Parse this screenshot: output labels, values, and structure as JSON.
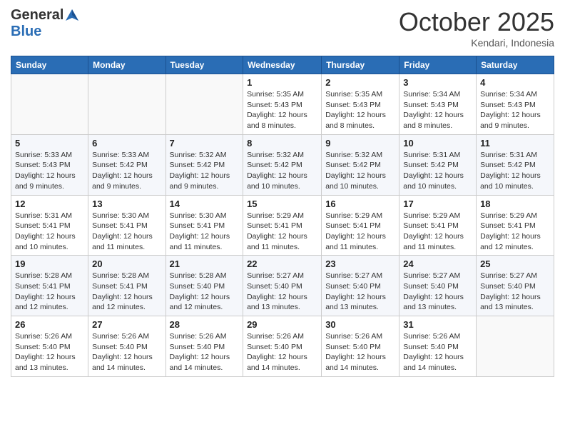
{
  "header": {
    "logo_general": "General",
    "logo_blue": "Blue",
    "month": "October 2025",
    "location": "Kendari, Indonesia"
  },
  "weekdays": [
    "Sunday",
    "Monday",
    "Tuesday",
    "Wednesday",
    "Thursday",
    "Friday",
    "Saturday"
  ],
  "weeks": [
    [
      {
        "day": "",
        "info": ""
      },
      {
        "day": "",
        "info": ""
      },
      {
        "day": "",
        "info": ""
      },
      {
        "day": "1",
        "info": "Sunrise: 5:35 AM\nSunset: 5:43 PM\nDaylight: 12 hours\nand 8 minutes."
      },
      {
        "day": "2",
        "info": "Sunrise: 5:35 AM\nSunset: 5:43 PM\nDaylight: 12 hours\nand 8 minutes."
      },
      {
        "day": "3",
        "info": "Sunrise: 5:34 AM\nSunset: 5:43 PM\nDaylight: 12 hours\nand 8 minutes."
      },
      {
        "day": "4",
        "info": "Sunrise: 5:34 AM\nSunset: 5:43 PM\nDaylight: 12 hours\nand 9 minutes."
      }
    ],
    [
      {
        "day": "5",
        "info": "Sunrise: 5:33 AM\nSunset: 5:43 PM\nDaylight: 12 hours\nand 9 minutes."
      },
      {
        "day": "6",
        "info": "Sunrise: 5:33 AM\nSunset: 5:42 PM\nDaylight: 12 hours\nand 9 minutes."
      },
      {
        "day": "7",
        "info": "Sunrise: 5:32 AM\nSunset: 5:42 PM\nDaylight: 12 hours\nand 9 minutes."
      },
      {
        "day": "8",
        "info": "Sunrise: 5:32 AM\nSunset: 5:42 PM\nDaylight: 12 hours\nand 10 minutes."
      },
      {
        "day": "9",
        "info": "Sunrise: 5:32 AM\nSunset: 5:42 PM\nDaylight: 12 hours\nand 10 minutes."
      },
      {
        "day": "10",
        "info": "Sunrise: 5:31 AM\nSunset: 5:42 PM\nDaylight: 12 hours\nand 10 minutes."
      },
      {
        "day": "11",
        "info": "Sunrise: 5:31 AM\nSunset: 5:42 PM\nDaylight: 12 hours\nand 10 minutes."
      }
    ],
    [
      {
        "day": "12",
        "info": "Sunrise: 5:31 AM\nSunset: 5:41 PM\nDaylight: 12 hours\nand 10 minutes."
      },
      {
        "day": "13",
        "info": "Sunrise: 5:30 AM\nSunset: 5:41 PM\nDaylight: 12 hours\nand 11 minutes."
      },
      {
        "day": "14",
        "info": "Sunrise: 5:30 AM\nSunset: 5:41 PM\nDaylight: 12 hours\nand 11 minutes."
      },
      {
        "day": "15",
        "info": "Sunrise: 5:29 AM\nSunset: 5:41 PM\nDaylight: 12 hours\nand 11 minutes."
      },
      {
        "day": "16",
        "info": "Sunrise: 5:29 AM\nSunset: 5:41 PM\nDaylight: 12 hours\nand 11 minutes."
      },
      {
        "day": "17",
        "info": "Sunrise: 5:29 AM\nSunset: 5:41 PM\nDaylight: 12 hours\nand 11 minutes."
      },
      {
        "day": "18",
        "info": "Sunrise: 5:29 AM\nSunset: 5:41 PM\nDaylight: 12 hours\nand 12 minutes."
      }
    ],
    [
      {
        "day": "19",
        "info": "Sunrise: 5:28 AM\nSunset: 5:41 PM\nDaylight: 12 hours\nand 12 minutes."
      },
      {
        "day": "20",
        "info": "Sunrise: 5:28 AM\nSunset: 5:41 PM\nDaylight: 12 hours\nand 12 minutes."
      },
      {
        "day": "21",
        "info": "Sunrise: 5:28 AM\nSunset: 5:40 PM\nDaylight: 12 hours\nand 12 minutes."
      },
      {
        "day": "22",
        "info": "Sunrise: 5:27 AM\nSunset: 5:40 PM\nDaylight: 12 hours\nand 13 minutes."
      },
      {
        "day": "23",
        "info": "Sunrise: 5:27 AM\nSunset: 5:40 PM\nDaylight: 12 hours\nand 13 minutes."
      },
      {
        "day": "24",
        "info": "Sunrise: 5:27 AM\nSunset: 5:40 PM\nDaylight: 12 hours\nand 13 minutes."
      },
      {
        "day": "25",
        "info": "Sunrise: 5:27 AM\nSunset: 5:40 PM\nDaylight: 12 hours\nand 13 minutes."
      }
    ],
    [
      {
        "day": "26",
        "info": "Sunrise: 5:26 AM\nSunset: 5:40 PM\nDaylight: 12 hours\nand 13 minutes."
      },
      {
        "day": "27",
        "info": "Sunrise: 5:26 AM\nSunset: 5:40 PM\nDaylight: 12 hours\nand 14 minutes."
      },
      {
        "day": "28",
        "info": "Sunrise: 5:26 AM\nSunset: 5:40 PM\nDaylight: 12 hours\nand 14 minutes."
      },
      {
        "day": "29",
        "info": "Sunrise: 5:26 AM\nSunset: 5:40 PM\nDaylight: 12 hours\nand 14 minutes."
      },
      {
        "day": "30",
        "info": "Sunrise: 5:26 AM\nSunset: 5:40 PM\nDaylight: 12 hours\nand 14 minutes."
      },
      {
        "day": "31",
        "info": "Sunrise: 5:26 AM\nSunset: 5:40 PM\nDaylight: 12 hours\nand 14 minutes."
      },
      {
        "day": "",
        "info": ""
      }
    ]
  ]
}
